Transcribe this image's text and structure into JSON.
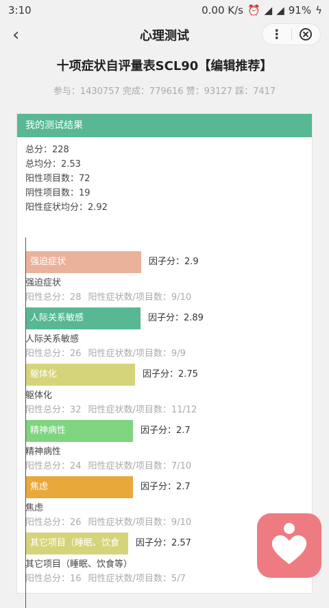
{
  "status": {
    "time": "3:10",
    "speed": "0.00 K/s",
    "battery": "91%"
  },
  "nav": {
    "title": "心理测试",
    "more": "⋮"
  },
  "test": {
    "title": "十项症状自评量表SCL90【编辑推荐】",
    "stats": "参与：1430757 完成：779616 赞：93127 踩：7417"
  },
  "result": {
    "header": "我的测试结果",
    "summary": [
      "总分：228",
      "总均分：2.53",
      "阳性项目数：72",
      "阴性项目数：19",
      "阳性症状均分：2.92"
    ]
  },
  "factors": [
    {
      "label": "强迫症状",
      "factor_text": "因子分：2.9",
      "score": 2.9,
      "name": "强迫症状",
      "positive_total": "阳性总分：28",
      "ratio": "阳性症状数/项目数：9/10",
      "color": "#ebb29b"
    },
    {
      "label": "人际关系敏感",
      "factor_text": "因子分：2.89",
      "score": 2.89,
      "name": "人际关系敏感",
      "positive_total": "阳性总分：26",
      "ratio": "阳性症状数/项目数：9/9",
      "color": "#57b893"
    },
    {
      "label": "躯体化",
      "factor_text": "因子分：2.75",
      "score": 2.75,
      "name": "躯体化",
      "positive_total": "阳性总分：32",
      "ratio": "阳性症状数/项目数：11/12",
      "color": "#d6d47a"
    },
    {
      "label": "精神病性",
      "factor_text": "因子分：2.7",
      "score": 2.7,
      "name": "精神病性",
      "positive_total": "阳性总分：24",
      "ratio": "阳性症状数/项目数：7/10",
      "color": "#7fd47f"
    },
    {
      "label": "焦虑",
      "factor_text": "因子分：2.7",
      "score": 2.7,
      "name": "焦虑",
      "positive_total": "阳性总分：26",
      "ratio": "阳性症状数/项目数：9/10",
      "color": "#e8a83a"
    },
    {
      "label": "其它项目（睡眠、饮食",
      "factor_text": "因子分：2.57",
      "score": 2.57,
      "name": "其它项目（睡眠、饮食等）",
      "positive_total": "阳性总分：16",
      "ratio": "阳性症状数/项目数：5/7",
      "color": "#d6d47a"
    }
  ]
}
